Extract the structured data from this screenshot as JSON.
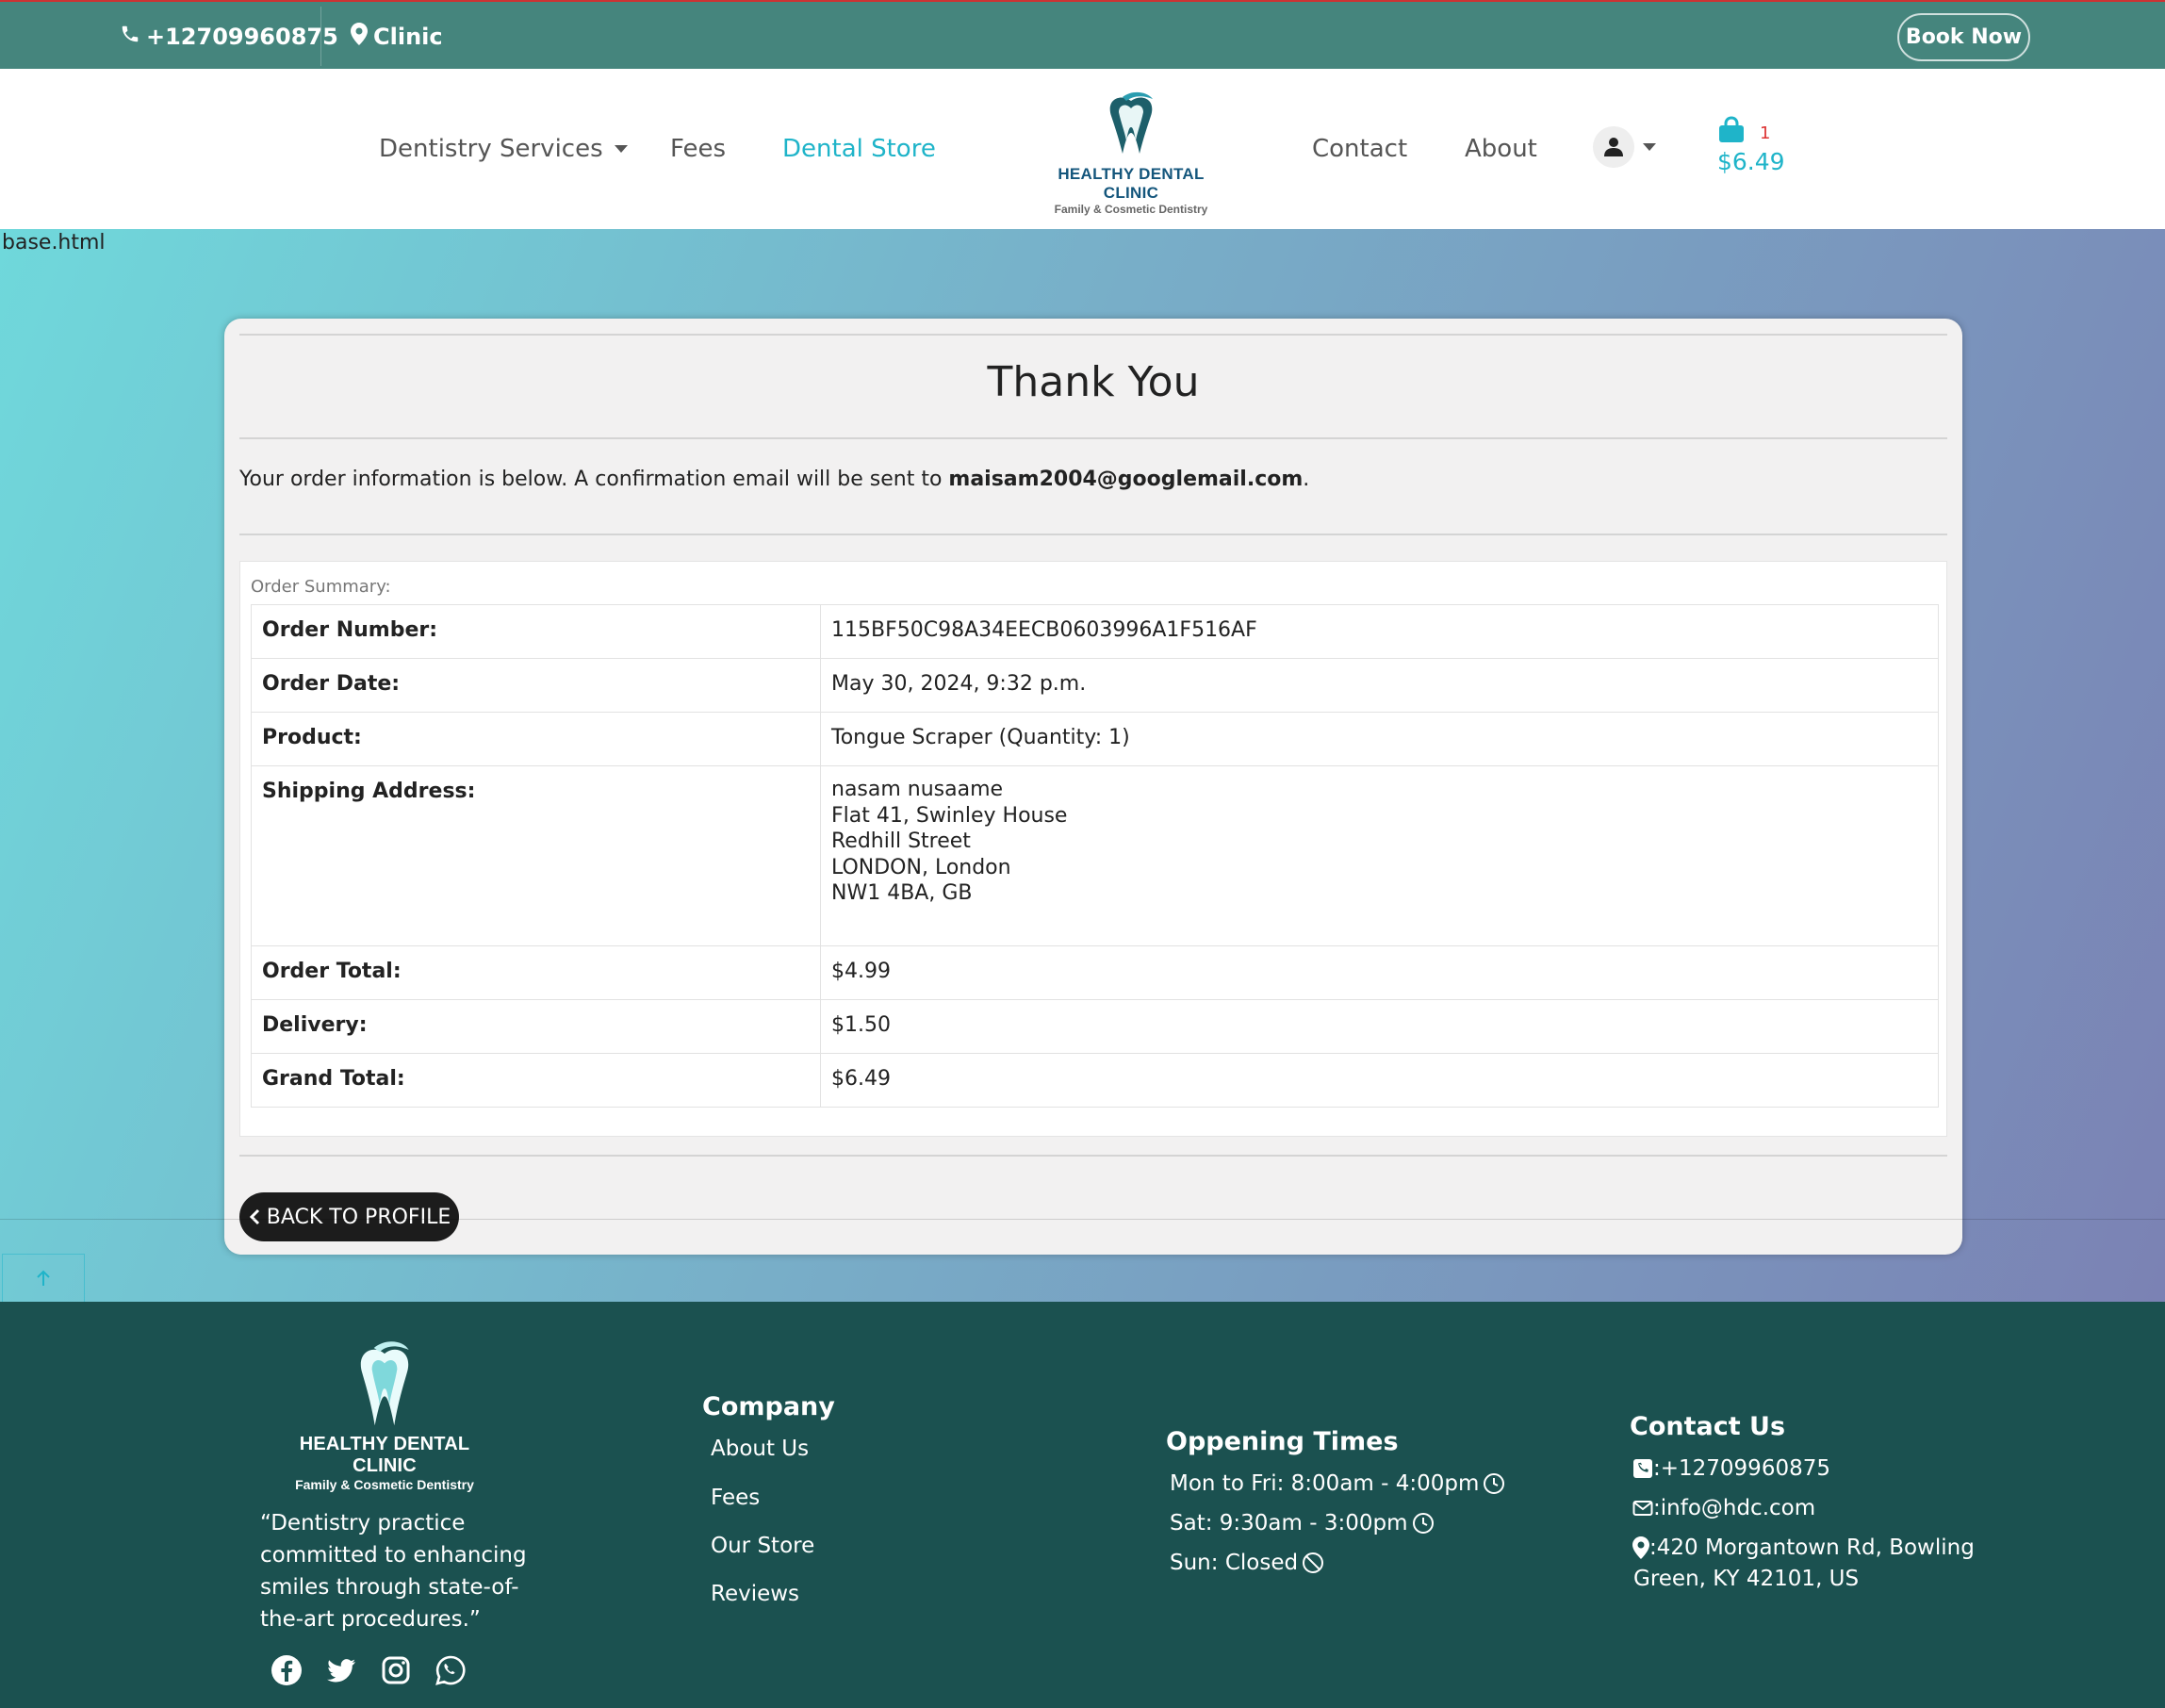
{
  "topbar": {
    "phone": "+12709960875",
    "location": "Clinic",
    "book_label": "Book Now"
  },
  "nav": {
    "services": "Dentistry Services",
    "fees": "Fees",
    "store": "Dental Store",
    "contact": "Contact",
    "about": "About",
    "logo_title": "HEALTHY DENTAL CLINIC",
    "logo_sub": "Family & Cosmetic Dentistry",
    "cart_count": "1",
    "cart_total": "$6.49"
  },
  "main": {
    "base_label": "base.html",
    "title": "Thank You",
    "intro_text": "Your order information is below. A confirmation email will be sent to ",
    "email": "maisam2004@googlemail.com",
    "intro_end": ".",
    "summary_label": "Order Summary:",
    "rows": [
      {
        "label": "Order Number:",
        "value": "115BF50C98A34EECB0603996A1F516AF"
      },
      {
        "label": "Order Date:",
        "value": "May 30, 2024, 9:32 p.m."
      },
      {
        "label": "Product:",
        "value": "Tongue Scraper (Quantity: 1)"
      },
      {
        "label": "Shipping Address:",
        "lines": [
          "nasam nusaame",
          "Flat 41, Swinley House",
          "Redhill Street",
          "LONDON, London",
          "NW1 4BA, GB"
        ]
      },
      {
        "label": "Order Total:",
        "value": "$4.99"
      },
      {
        "label": "Delivery:",
        "value": "$1.50"
      },
      {
        "label": "Grand Total:",
        "value": "$6.49"
      }
    ],
    "back_label": "BACK TO PROFILE"
  },
  "footer": {
    "logo_title": "HEALTHY DENTAL CLINIC",
    "logo_sub": "Family & Cosmetic Dentistry",
    "quote": "“Dentistry practice committed to enhancing smiles through state-of-the-art procedures.”",
    "company_title": "Company",
    "company_links": [
      "About Us",
      "Fees",
      "Our Store",
      "Reviews"
    ],
    "hours_title": "Oppening Times",
    "hours": [
      "Mon to Fri: 8:00am - 4:00pm",
      "Sat: 9:30am - 3:00pm",
      "Sun: Closed"
    ],
    "contact_title": "Contact Us",
    "contact_phone": ":+12709960875",
    "contact_email": ":info@hdc.com",
    "contact_address_1": ":420 Morgantown Rd, Bowling",
    "contact_address_2": "Green, KY 42101, US"
  },
  "colors": {
    "topbar": "#45857d",
    "accent": "#1fb4c9",
    "footer": "#1b5150",
    "button_dark": "#1c1c1c"
  },
  "icons": [
    "phone-icon",
    "map-pin-icon",
    "user-icon",
    "shopping-bag-icon",
    "chevron-left-icon",
    "arrow-up-icon",
    "facebook-icon",
    "twitter-icon",
    "instagram-icon",
    "whatsapp-icon",
    "clock-icon",
    "ban-icon",
    "phone-square-icon",
    "envelope-icon"
  ]
}
